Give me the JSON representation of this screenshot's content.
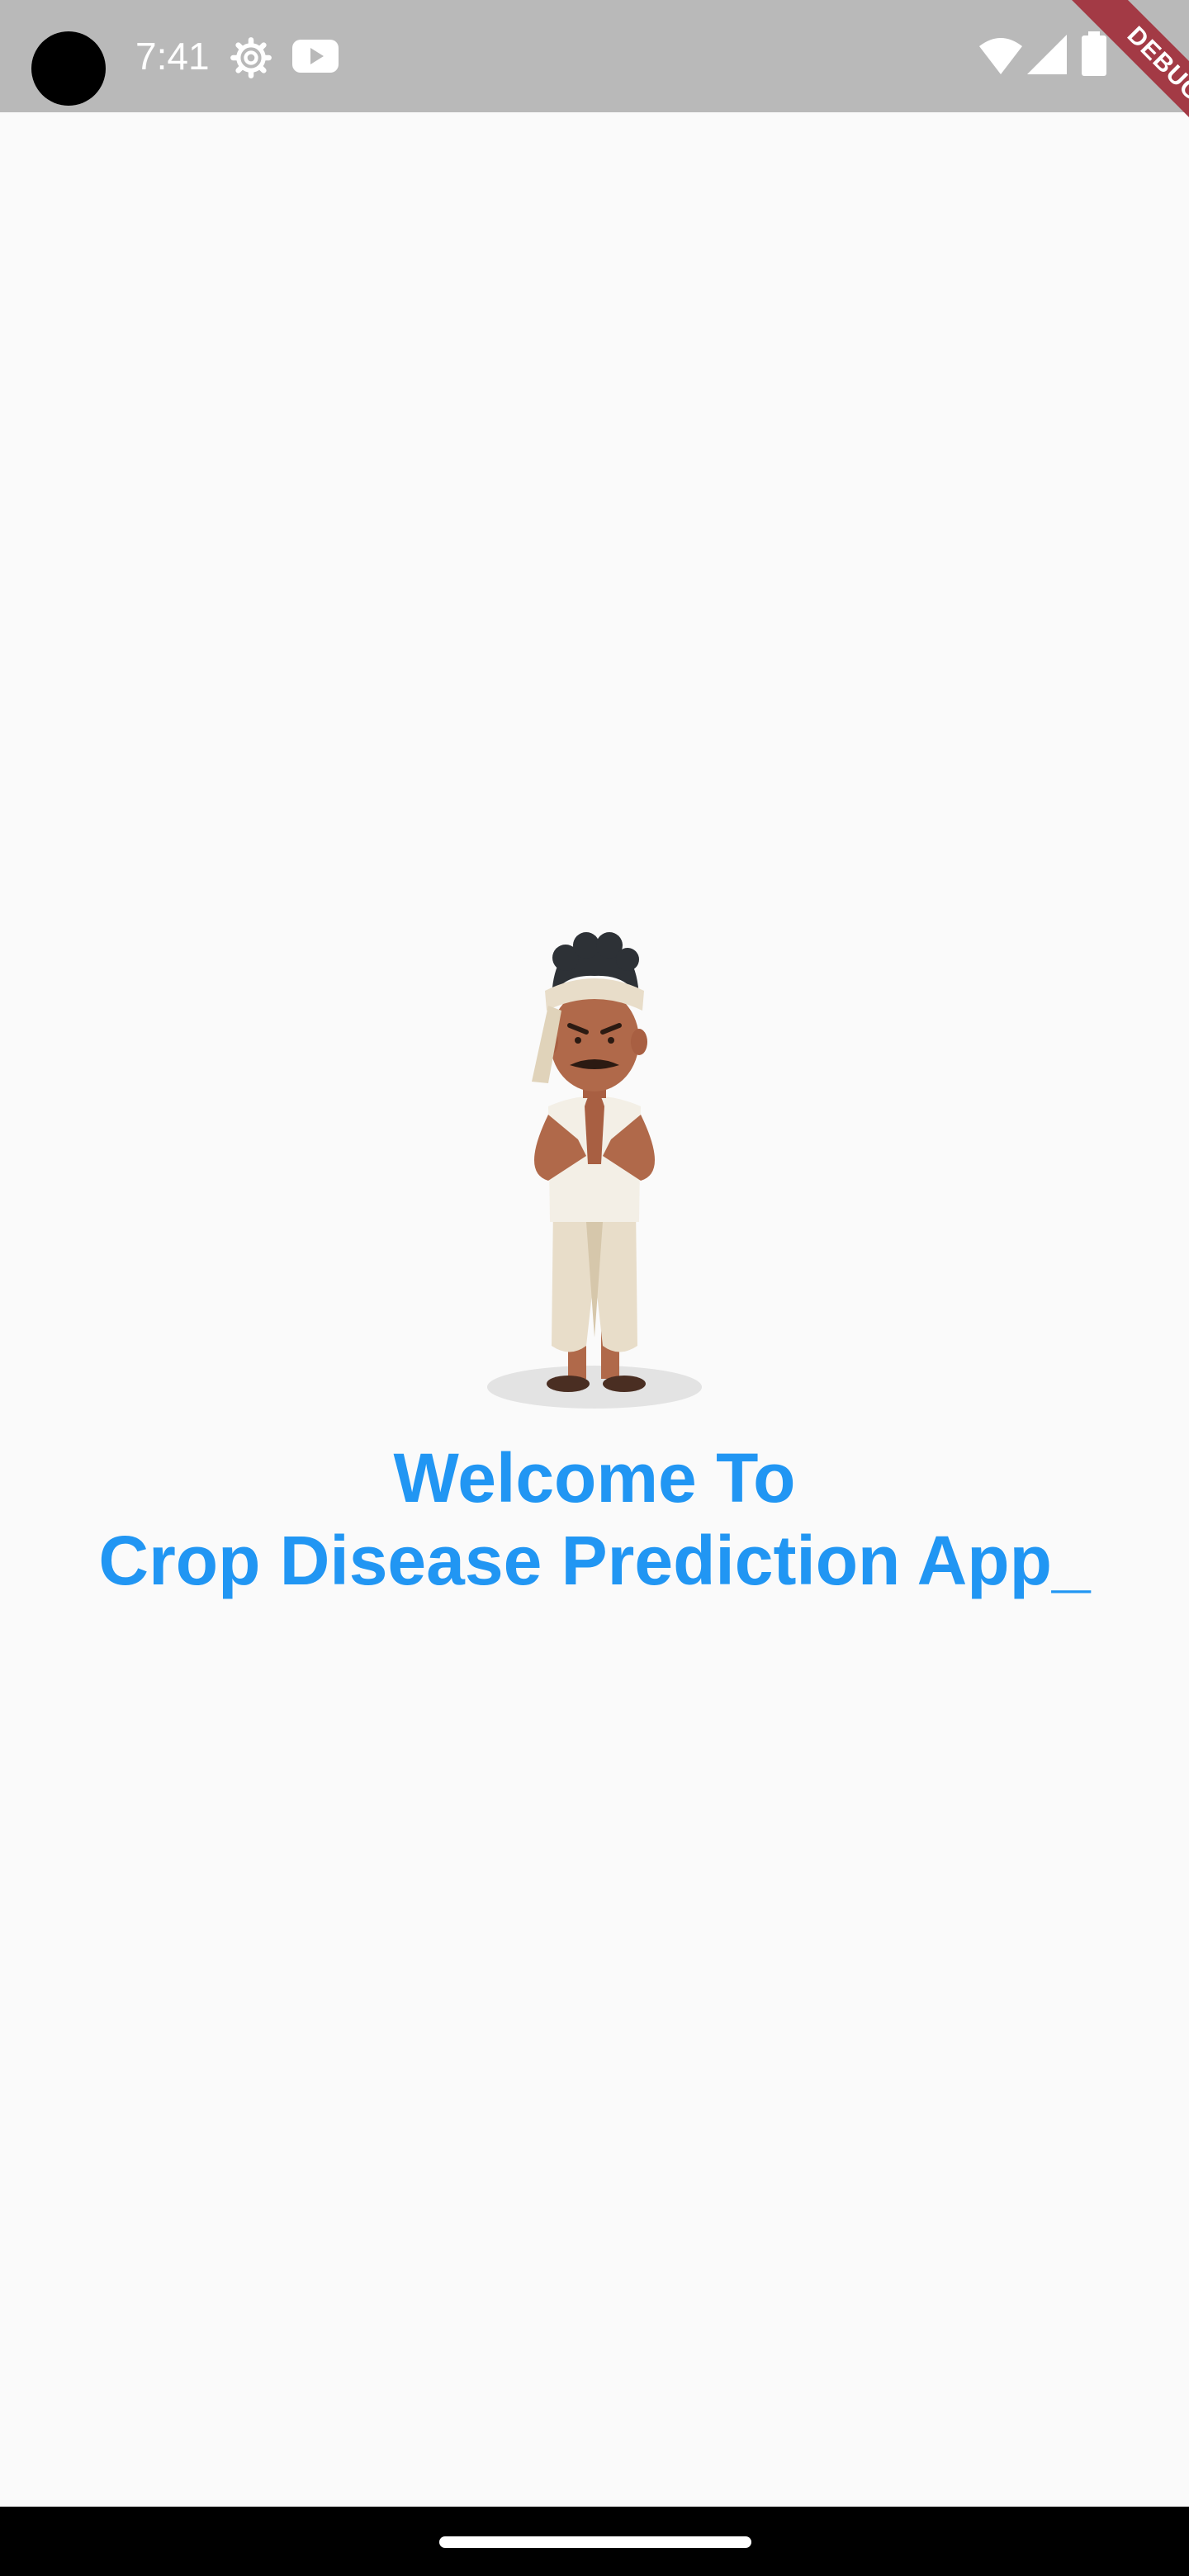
{
  "status_bar": {
    "time": "7:41",
    "icons": [
      "gear-icon",
      "youtube-icon",
      "wifi-icon",
      "signal-icon",
      "battery-icon"
    ]
  },
  "debug_banner": {
    "label": "DEBUG",
    "color": "#a33a45"
  },
  "illustration": {
    "icon": "farmer-namaste-illustration"
  },
  "welcome": {
    "line1": "Welcome To",
    "line2": "Crop Disease Prediction App_",
    "color": "#2196f3"
  },
  "nav_bar": {
    "icons": [
      "home-handle"
    ]
  }
}
